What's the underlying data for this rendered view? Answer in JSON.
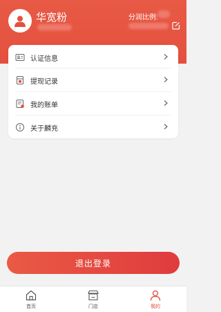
{
  "header": {
    "username": "华宽粉",
    "ratio_label": "分润比例:"
  },
  "menu": [
    {
      "icon": "id-card-icon",
      "label": "认证信息"
    },
    {
      "icon": "withdraw-record-icon",
      "label": "提现记录"
    },
    {
      "icon": "bill-icon",
      "label": "我的账单"
    },
    {
      "icon": "info-icon",
      "label": "关于麟充"
    }
  ],
  "logout_label": "退出登录",
  "tabbar": [
    {
      "icon": "home-icon",
      "label": "首页"
    },
    {
      "icon": "store-icon",
      "label": "门店"
    },
    {
      "icon": "user-icon",
      "label": "我的",
      "active": true
    }
  ],
  "colors": {
    "accent": "#e4503f",
    "active_tab": "#e04a3e"
  }
}
